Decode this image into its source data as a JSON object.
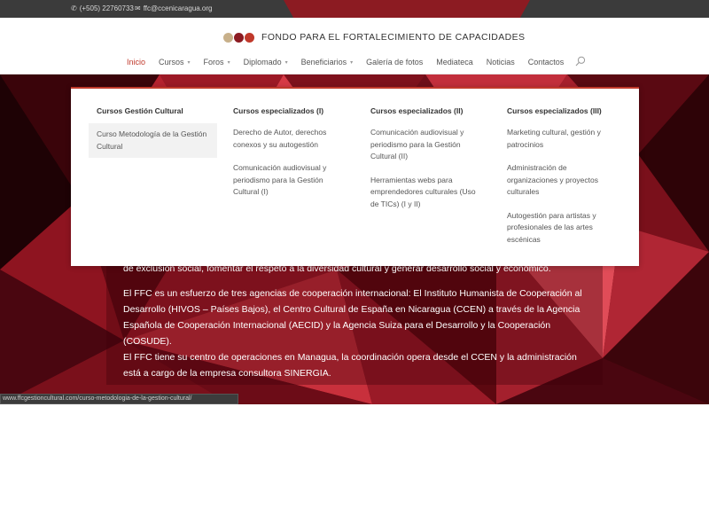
{
  "topbar": {
    "phone": "(+505) 22760733",
    "email": "ffc@ccenicaragua.org",
    "phone_icon": "phone-icon",
    "email_icon": "envelope-icon"
  },
  "logo": {
    "text": "FONDO PARA EL FORTALECIMIENTO DE CAPACIDADES",
    "colors": [
      "#c8b08a",
      "#8c1b22",
      "#c0392b"
    ]
  },
  "nav": {
    "items": [
      {
        "label": "Inicio",
        "active": true,
        "dropdown": false
      },
      {
        "label": "Cursos",
        "dropdown": true
      },
      {
        "label": "Foros",
        "dropdown": true
      },
      {
        "label": "Diplomado",
        "dropdown": true
      },
      {
        "label": "Beneficiarios",
        "dropdown": true
      },
      {
        "label": "Galería de fotos",
        "dropdown": false
      },
      {
        "label": "Mediateca",
        "dropdown": false
      },
      {
        "label": "Noticias",
        "dropdown": false
      },
      {
        "label": "Contactos",
        "dropdown": false
      }
    ],
    "caret": "▾"
  },
  "mega_menu": {
    "columns": [
      {
        "heading": "Cursos Gestión Cultural",
        "links": [
          "Curso Metodología de la Gestión Cultural"
        ]
      },
      {
        "heading": "Cursos especializados (I)",
        "links": [
          "Derecho de Autor, derechos conexos y su autogestión",
          "Comunicación audiovisual y periodismo para la Gestión Cultural (I)"
        ]
      },
      {
        "heading": "Cursos especializados (II)",
        "links": [
          "Comunicación audiovisual y periodismo para la Gestión Cultural (II)",
          "Herramientas webs para emprendedores culturales (Uso de TICs) (I y II)"
        ]
      },
      {
        "heading": "Cursos especializados (III)",
        "links": [
          "Marketing cultural, gestión y patrocinios",
          "Administración de organizaciones y proyectos culturales",
          "Autogestión para artistas y profesionales de las artes escénicas"
        ]
      }
    ]
  },
  "hero": {
    "paragraph_partial": "de exclusión social, fomentar el respeto a la diversidad cultural y generar desarrollo social y económico.",
    "paragraph_2": "El FFC es un esfuerzo de tres agencias de cooperación internacional: El Instituto Humanista de Cooperación al Desarrollo (HIVOS – Países Bajos), el Centro Cultural de España en Nicaragua (CCEN) a través de la Agencia Española de Cooperación Internacional (AECID) y la Agencia Suiza para el Desarrollo y la Cooperación (COSUDE).",
    "paragraph_3": "El FFC tiene su centro de operaciones en Managua, la coordinación opera desde el CCEN y la administración está a cargo de la empresa consultora SINERGIA."
  },
  "status_url": "www.ffcgestioncultural.com/curso-metodologia-de-la-gestion-cultural/",
  "colors": {
    "accent": "#c0392b",
    "topbar_bg": "#3b3b3b",
    "hero_bg": "#5a0a12"
  }
}
